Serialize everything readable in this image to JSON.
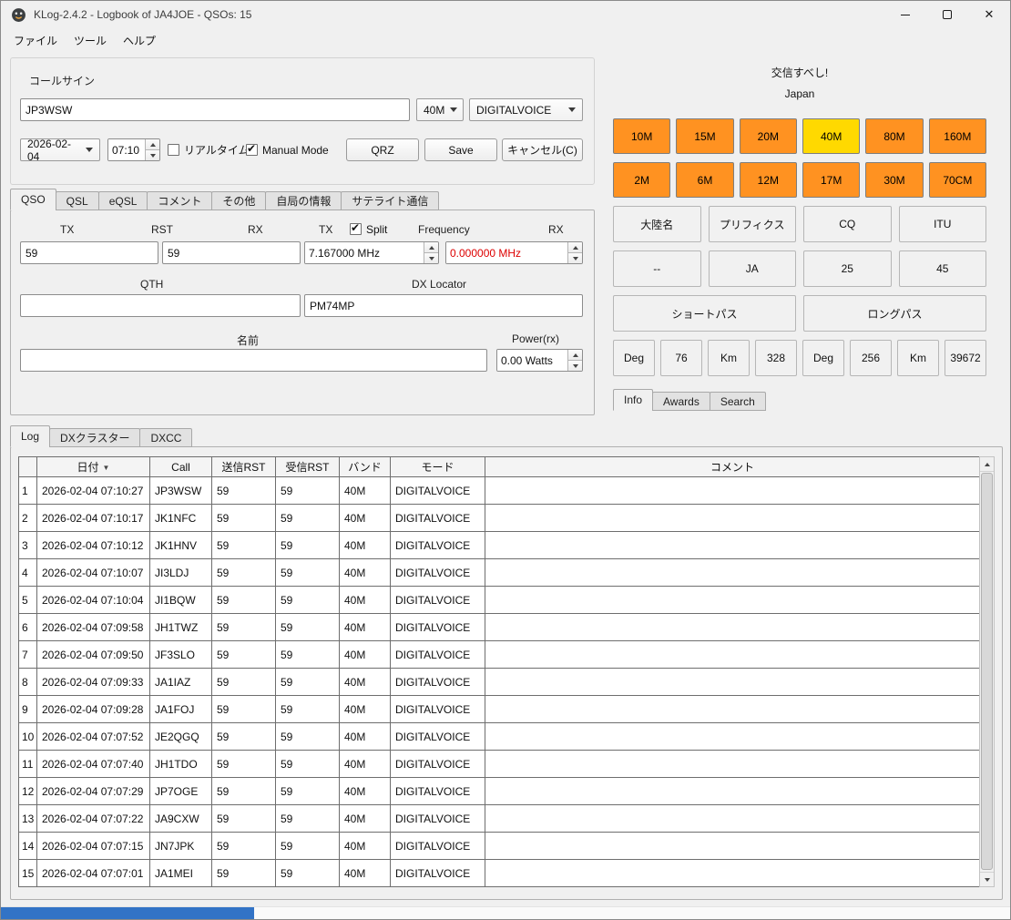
{
  "window": {
    "title": "KLog-2.4.2 - Logbook of JA4JOE - QSOs: 15",
    "close_glyph": "✕"
  },
  "menu": {
    "items": [
      {
        "label": "ファイル"
      },
      {
        "label": "ツール"
      },
      {
        "label": "ヘルプ"
      }
    ]
  },
  "entry": {
    "group_title": "コールサイン",
    "callsign": "JP3WSW",
    "band": "40M",
    "mode": "DIGITALVOICE",
    "date": "2026-02-04",
    "time": "07:10",
    "realtime_label": "リアルタイム",
    "realtime_checked": false,
    "manual_label": "Manual Mode",
    "manual_checked": true,
    "buttons": {
      "qrz": "QRZ",
      "save": "Save",
      "cancel": "キャンセル(C)"
    }
  },
  "qso_tabs": {
    "items": [
      {
        "label": "QSO",
        "active": true
      },
      {
        "label": "QSL"
      },
      {
        "label": "eQSL"
      },
      {
        "label": "コメント"
      },
      {
        "label": "その他"
      },
      {
        "label": "自局の情報"
      },
      {
        "label": "サテライト通信"
      }
    ]
  },
  "qso_form": {
    "labels": {
      "tx1": "TX",
      "rst": "RST",
      "rx1": "RX",
      "tx2": "TX",
      "split": "Split",
      "frequency": "Frequency",
      "rx2": "RX",
      "qth": "QTH",
      "dx_locator": "DX Locator",
      "name": "名前",
      "power": "Power(rx)"
    },
    "split_checked": true,
    "rst_tx": "59",
    "rst_rx": "59",
    "freq_tx": "7.167000 MHz",
    "freq_rx": "0.000000 MHz",
    "qth": "",
    "dx_locator": "PM74MP",
    "name": "",
    "power": "0.00 Watts"
  },
  "dx_panel": {
    "title": "交信すべし!",
    "subtitle": "Japan",
    "bands": [
      {
        "label": "10M",
        "state": "orange"
      },
      {
        "label": "15M",
        "state": "orange"
      },
      {
        "label": "20M",
        "state": "orange"
      },
      {
        "label": "40M",
        "state": "yellow"
      },
      {
        "label": "80M",
        "state": "orange"
      },
      {
        "label": "160M",
        "state": "orange"
      },
      {
        "label": "2M",
        "state": "orange"
      },
      {
        "label": "6M",
        "state": "orange"
      },
      {
        "label": "12M",
        "state": "orange"
      },
      {
        "label": "17M",
        "state": "orange"
      },
      {
        "label": "30M",
        "state": "orange"
      },
      {
        "label": "70CM",
        "state": "orange"
      }
    ],
    "info_headers": [
      "大陸名",
      "プリフィクス",
      "CQ",
      "ITU"
    ],
    "info_values": [
      "--",
      "JA",
      "25",
      "45"
    ],
    "paths": [
      "ショートパス",
      "ロングパス"
    ],
    "bearing": [
      "Deg",
      "76",
      "Km",
      "328",
      "Deg",
      "256",
      "Km",
      "39672"
    ],
    "tabs": [
      {
        "label": "Info",
        "active": true
      },
      {
        "label": "Awards"
      },
      {
        "label": "Search"
      }
    ]
  },
  "log_panel": {
    "tabs": [
      {
        "label": "Log",
        "active": true
      },
      {
        "label": "DXクラスター"
      },
      {
        "label": "DXCC"
      }
    ],
    "columns": [
      "日付",
      "Call",
      "送信RST",
      "受信RST",
      "バンド",
      "モード",
      "コメント"
    ],
    "sort_column": "日付",
    "sort_indicator": "▼",
    "rows": [
      [
        "1",
        "2026-02-04 07:10:27",
        "JP3WSW",
        "59",
        "59",
        "40M",
        "DIGITALVOICE",
        ""
      ],
      [
        "2",
        "2026-02-04 07:10:17",
        "JK1NFC",
        "59",
        "59",
        "40M",
        "DIGITALVOICE",
        ""
      ],
      [
        "3",
        "2026-02-04 07:10:12",
        "JK1HNV",
        "59",
        "59",
        "40M",
        "DIGITALVOICE",
        ""
      ],
      [
        "4",
        "2026-02-04 07:10:07",
        "JI3LDJ",
        "59",
        "59",
        "40M",
        "DIGITALVOICE",
        ""
      ],
      [
        "5",
        "2026-02-04 07:10:04",
        "JI1BQW",
        "59",
        "59",
        "40M",
        "DIGITALVOICE",
        ""
      ],
      [
        "6",
        "2026-02-04 07:09:58",
        "JH1TWZ",
        "59",
        "59",
        "40M",
        "DIGITALVOICE",
        ""
      ],
      [
        "7",
        "2026-02-04 07:09:50",
        "JF3SLO",
        "59",
        "59",
        "40M",
        "DIGITALVOICE",
        ""
      ],
      [
        "8",
        "2026-02-04 07:09:33",
        "JA1IAZ",
        "59",
        "59",
        "40M",
        "DIGITALVOICE",
        ""
      ],
      [
        "9",
        "2026-02-04 07:09:28",
        "JA1FOJ",
        "59",
        "59",
        "40M",
        "DIGITALVOICE",
        ""
      ],
      [
        "10",
        "2026-02-04 07:07:52",
        "JE2QGQ",
        "59",
        "59",
        "40M",
        "DIGITALVOICE",
        ""
      ],
      [
        "11",
        "2026-02-04 07:07:40",
        "JH1TDO",
        "59",
        "59",
        "40M",
        "DIGITALVOICE",
        ""
      ],
      [
        "12",
        "2026-02-04 07:07:29",
        "JP7OGE",
        "59",
        "59",
        "40M",
        "DIGITALVOICE",
        ""
      ],
      [
        "13",
        "2026-02-04 07:07:22",
        "JA9CXW",
        "59",
        "59",
        "40M",
        "DIGITALVOICE",
        ""
      ],
      [
        "14",
        "2026-02-04 07:07:15",
        "JN7JPK",
        "59",
        "59",
        "40M",
        "DIGITALVOICE",
        ""
      ],
      [
        "15",
        "2026-02-04 07:07:01",
        "JA1MEI",
        "59",
        "59",
        "40M",
        "DIGITALVOICE",
        ""
      ]
    ]
  },
  "colors": {
    "band_orange": "#ff9221",
    "band_yellow": "#ffd900",
    "freq_rx_red": "#dd0000",
    "progress_blue": "#3273c6"
  }
}
